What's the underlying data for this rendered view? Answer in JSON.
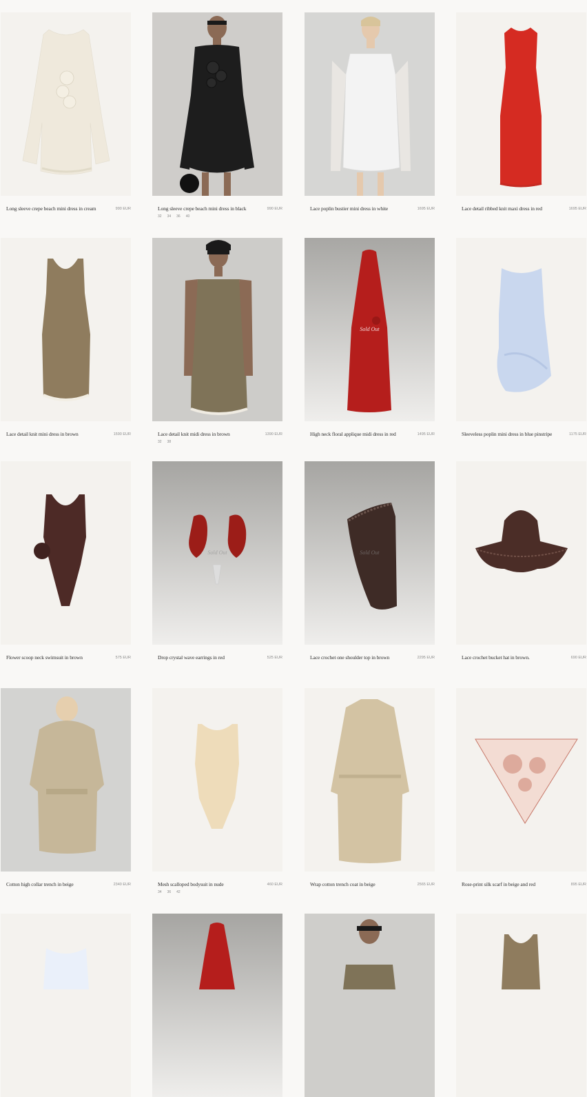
{
  "products": [
    {
      "name": "Long sleeve crepe beach mini dress in cream",
      "price": "990 EUR",
      "sizes": [],
      "sold_out": ""
    },
    {
      "name": "Long sleeve crepe beach mini dress in black",
      "price": "990 EUR",
      "sizes": [
        "32",
        "34",
        "36",
        "40"
      ],
      "sold_out": ""
    },
    {
      "name": "Lace poplin bustier mini dress in white",
      "price": "1695 EUR",
      "sizes": [],
      "sold_out": ""
    },
    {
      "name": "Lace detail ribbed knit maxi dress in red",
      "price": "1695 EUR",
      "sizes": [],
      "sold_out": ""
    },
    {
      "name": "Lace detail knit mini dress in brown",
      "price": "1590 EUR",
      "sizes": [],
      "sold_out": ""
    },
    {
      "name": "Lace detail knit midi dress in brown",
      "price": "1390 EUR",
      "sizes": [
        "32",
        "38"
      ],
      "sold_out": ""
    },
    {
      "name": "High neck floral applique midi dress in red",
      "price": "1495 EUR",
      "sizes": [],
      "sold_out": "Sold Out"
    },
    {
      "name": "Sleeveless poplin mini dress in blue pinstripe",
      "price": "1175 EUR",
      "sizes": [],
      "sold_out": ""
    },
    {
      "name": "Flower scoop neck swimsuit in brown",
      "price": "575 EUR",
      "sizes": [],
      "sold_out": ""
    },
    {
      "name": "Drop crystal wave earrings in red",
      "price": "525 EUR",
      "sizes": [],
      "sold_out": "Sold Out"
    },
    {
      "name": "Lace crochet one shoulder top in brown",
      "price": "2295 EUR",
      "sizes": [],
      "sold_out": "Sold Out"
    },
    {
      "name": "Lace crochet bucket hat in brown.",
      "price": "690 EUR",
      "sizes": [],
      "sold_out": ""
    },
    {
      "name": "Cotton high collar trench in beige",
      "price": "2340 EUR",
      "sizes": [],
      "sold_out": ""
    },
    {
      "name": "Mesh scalloped bodysuit in nude",
      "price": "460 EUR",
      "sizes": [
        "34",
        "36",
        "42"
      ],
      "sold_out": ""
    },
    {
      "name": "Wrap cotton trench coat in beige",
      "price": "2565 EUR",
      "sizes": [],
      "sold_out": ""
    },
    {
      "name": "Rose-print silk scarf in beige and red",
      "price": "895 EUR",
      "sizes": [],
      "sold_out": ""
    }
  ],
  "colors": {
    "page_background": "#f9f8f6",
    "product_background": "#f4f2ee",
    "studio_gray": "#c9c8c5",
    "price_text": "#8a8a8a"
  }
}
